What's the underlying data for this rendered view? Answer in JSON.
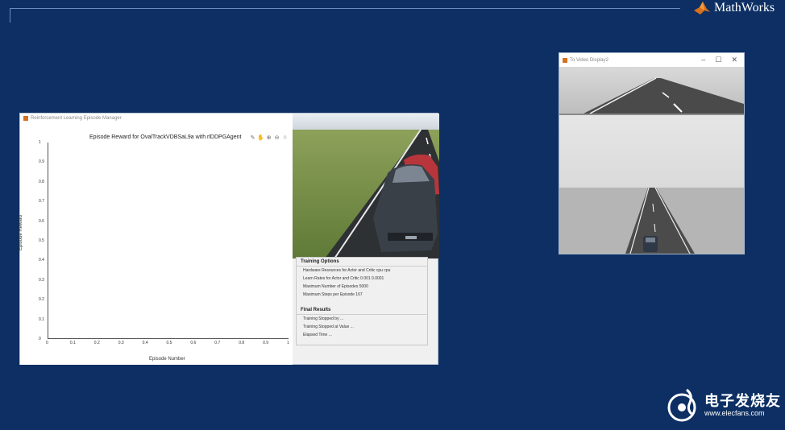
{
  "brand": {
    "name": "MathWorks"
  },
  "episode_manager": {
    "window_title": "Reinforcement Learning Episode Manager",
    "plot_title": "Episode Reward for OvalTrackVDBSaL9a with rlDDPGAgent",
    "y_label": "Episode Reward",
    "x_label": "Episode Number",
    "y_ticks": [
      "0",
      "0.1",
      "0.2",
      "0.3",
      "0.4",
      "0.5",
      "0.6",
      "0.7",
      "0.8",
      "0.9",
      "1"
    ],
    "x_ticks": [
      "0",
      "0.1",
      "0.2",
      "0.3",
      "0.4",
      "0.5",
      "0.6",
      "0.7",
      "0.8",
      "0.9",
      "1"
    ],
    "training_options": {
      "heading": "Training Options",
      "rows": [
        "Hardware Resources for Actor and Critic    cpu    cpu",
        "Learn Rates for Actor and Critic    0.001    0.0001",
        "Maximum Number of Episodes    5000",
        "Maximum Steps per Episode    167"
      ]
    },
    "final_results": {
      "heading": "Final Results",
      "rows": [
        "Training Stopped by    ...",
        "Training Stopped at Value    ...",
        "Elapsed Time    ..."
      ]
    }
  },
  "video_display": {
    "window_title": "To Video Display2",
    "controls": [
      "–",
      "☐",
      "✕"
    ]
  },
  "watermark": {
    "cn": "电子发烧友",
    "url": "www.elecfans.com"
  },
  "colors": {
    "background": "#0d2f63",
    "accent": "#d6711f"
  }
}
